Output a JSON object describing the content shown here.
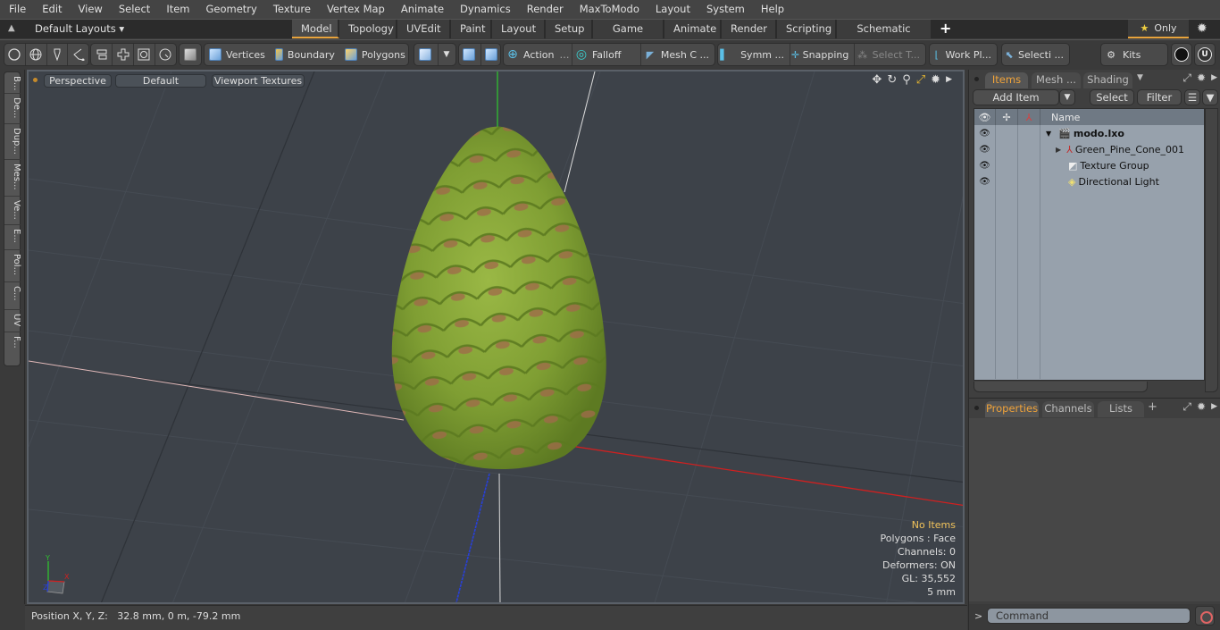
{
  "menu": [
    "File",
    "Edit",
    "View",
    "Select",
    "Item",
    "Geometry",
    "Texture",
    "Vertex Map",
    "Animate",
    "Dynamics",
    "Render",
    "MaxToModo",
    "Layout",
    "System",
    "Help"
  ],
  "layout_bar": {
    "layouts_label": "Default Layouts",
    "tabs": [
      "Model",
      "Topology",
      "UVEdit",
      "Paint",
      "Layout",
      "Setup",
      "Game Tools",
      "Animate",
      "Render",
      "Scripting",
      "Schematic Fusion"
    ],
    "active_tab": "Model",
    "only_label": "Only"
  },
  "toolbar": {
    "vertices": "Vertices",
    "boundary": "Boundary",
    "polygons": "Polygons",
    "action": "Action",
    "falloff": "Falloff",
    "mesh_c": "Mesh C ...",
    "symm": "Symm ...",
    "snapping": "Snapping",
    "select_t": "Select T...",
    "work_pl": "Work Pl...",
    "selecti": "Selecti ...",
    "kits": "Kits"
  },
  "left_tabs": [
    "B...",
    "De...",
    "Dup...",
    "Mes...",
    "Ve...",
    "E...",
    "Pol...",
    "C...",
    "UV",
    "F..."
  ],
  "viewport": {
    "view": "Perspective",
    "shading": "Default",
    "textures": "Viewport Textures",
    "stats": {
      "selection": "No Items",
      "polygons": "Polygons : Face",
      "channels": "Channels: 0",
      "deformers": "Deformers: ON",
      "gl": "GL: 35,552",
      "scale": "5 mm"
    },
    "axis_x": "X",
    "axis_y": "Y",
    "axis_z": "Z"
  },
  "status": {
    "position": "Position X, Y, Z:   32.8 mm, 0 m, -79.2 mm"
  },
  "items_panel": {
    "tabs": [
      "Items",
      "Mesh ...",
      "Shading"
    ],
    "active_tab": "Items",
    "add_item": "Add Item",
    "select": "Select",
    "filter": "Filter",
    "name_header": "Name",
    "tree": [
      {
        "name": "modo.lxo",
        "level": 0,
        "bold": true,
        "icon": "scene-icon"
      },
      {
        "name": "Green_Pine_Cone_001",
        "level": 1,
        "icon": "mesh-locator-icon"
      },
      {
        "name": "Texture Group",
        "level": 1,
        "icon": "texture-group-icon"
      },
      {
        "name": "Directional Light",
        "level": 1,
        "icon": "light-icon"
      }
    ]
  },
  "props_panel": {
    "tabs": [
      "Properties",
      "Channels",
      "Lists"
    ],
    "active_tab": "Properties"
  },
  "command": {
    "placeholder": "Command"
  },
  "colors": {
    "accent": "#e8a33c",
    "viewport_bg": "#3d4249",
    "tree_bg": "#97a1ac"
  }
}
